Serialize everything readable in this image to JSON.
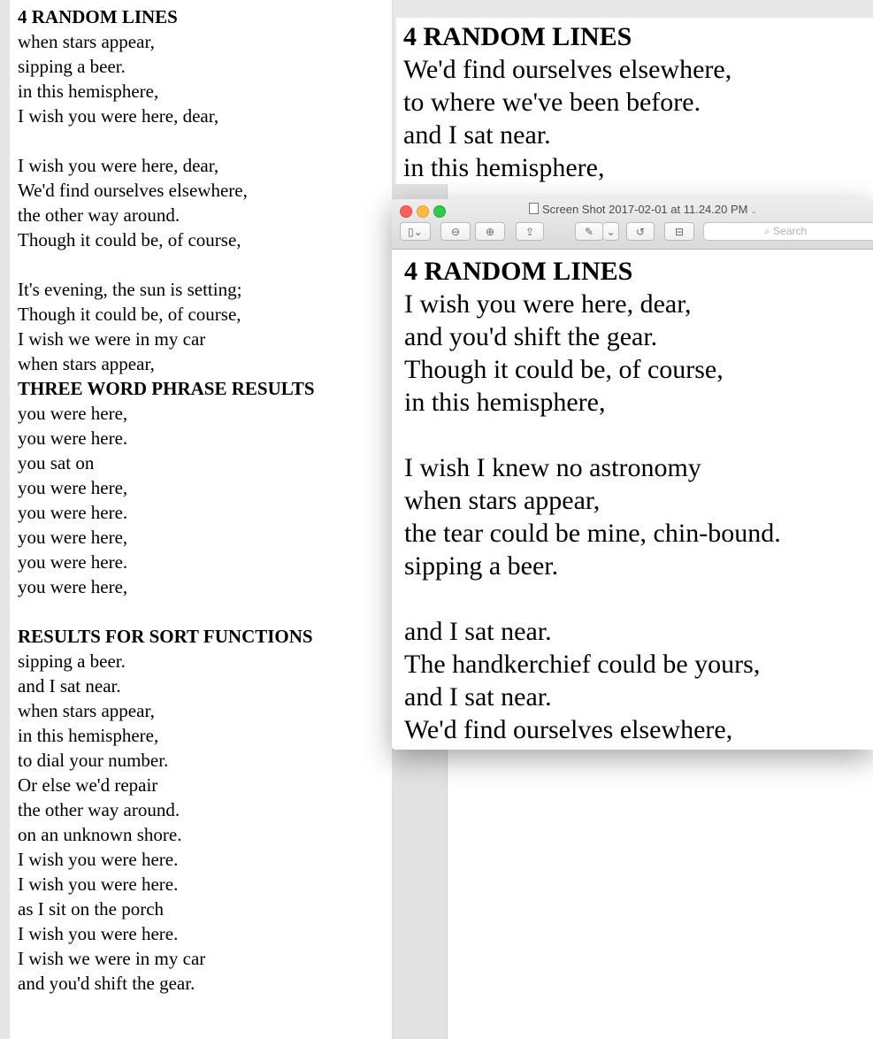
{
  "left_doc": {
    "lines": [
      {
        "text": "4 RANDOM LINES",
        "kind": "heading"
      },
      {
        "text": "when stars appear,",
        "kind": "text"
      },
      {
        "text": "sipping a beer.",
        "kind": "text"
      },
      {
        "text": "in this hemisphere,",
        "kind": "text"
      },
      {
        "text": "I wish you were here, dear,",
        "kind": "text"
      },
      {
        "text": "",
        "kind": "blank"
      },
      {
        "text": "I wish you were here, dear,",
        "kind": "text"
      },
      {
        "text": "We'd find ourselves elsewhere,",
        "kind": "text"
      },
      {
        "text": "the other way around.",
        "kind": "text"
      },
      {
        "text": "Though it could be, of course,",
        "kind": "text"
      },
      {
        "text": "",
        "kind": "blank"
      },
      {
        "text": "It's evening, the sun is setting;",
        "kind": "text"
      },
      {
        "text": "Though it could be, of course,",
        "kind": "text"
      },
      {
        "text": "I wish we were in my car",
        "kind": "text"
      },
      {
        "text": "when stars appear,",
        "kind": "text"
      },
      {
        "text": "THREE WORD PHRASE RESULTS",
        "kind": "heading"
      },
      {
        "text": "you were here,",
        "kind": "text"
      },
      {
        "text": "you were here.",
        "kind": "text"
      },
      {
        "text": "you sat on",
        "kind": "text"
      },
      {
        "text": "you were here,",
        "kind": "text"
      },
      {
        "text": "you were here.",
        "kind": "text"
      },
      {
        "text": "you were here,",
        "kind": "text"
      },
      {
        "text": "you were here.",
        "kind": "text"
      },
      {
        "text": "you were here,",
        "kind": "text"
      },
      {
        "text": "",
        "kind": "blank"
      },
      {
        "text": "RESULTS FOR SORT FUNCTIONS",
        "kind": "heading"
      },
      {
        "text": "sipping a beer.",
        "kind": "text"
      },
      {
        "text": "and I sat near.",
        "kind": "text"
      },
      {
        "text": "when stars appear,",
        "kind": "text"
      },
      {
        "text": "in this hemisphere,",
        "kind": "text"
      },
      {
        "text": "to dial your number.",
        "kind": "text"
      },
      {
        "text": "Or else we'd repair",
        "kind": "text"
      },
      {
        "text": "the other way around.",
        "kind": "text"
      },
      {
        "text": "on an unknown shore.",
        "kind": "text"
      },
      {
        "text": "I wish you were here.",
        "kind": "text"
      },
      {
        "text": "I wish you were here.",
        "kind": "text"
      },
      {
        "text": "as I sit on the porch",
        "kind": "text"
      },
      {
        "text": "I wish you were here.",
        "kind": "text"
      },
      {
        "text": "I wish we were in my car",
        "kind": "text"
      },
      {
        "text": "and you'd shift the gear.",
        "kind": "text"
      }
    ]
  },
  "top_window": {
    "lines": [
      {
        "text": "4 RANDOM LINES",
        "kind": "heading"
      },
      {
        "text": "We'd find ourselves elsewhere,",
        "kind": "text"
      },
      {
        "text": "to where we've been before.",
        "kind": "text"
      },
      {
        "text": "and I sat near.",
        "kind": "text"
      },
      {
        "text": "in this hemisphere,",
        "kind": "text"
      }
    ]
  },
  "preview_window": {
    "title": "Screen Shot 2017-02-01 at 11.24.20 PM",
    "title_chevron": "⌄",
    "toolbar": {
      "sidebar_icon": "▯⌄",
      "zoom_out_icon": "⊖",
      "zoom_in_icon": "⊕",
      "share_icon": "⇪",
      "markup_icon": "✎",
      "markup_menu_icon": "⌄",
      "rotate_icon": "↺",
      "toolbox_icon": "⊟",
      "search_icon": "⌕",
      "search_placeholder": "Search"
    },
    "lines": [
      {
        "text": "4 RANDOM LINES",
        "kind": "heading"
      },
      {
        "text": "I wish you were here, dear,",
        "kind": "text"
      },
      {
        "text": "and you'd shift the gear.",
        "kind": "text"
      },
      {
        "text": "Though it could be, of course,",
        "kind": "text"
      },
      {
        "text": "in this hemisphere,",
        "kind": "text"
      },
      {
        "text": "",
        "kind": "blank"
      },
      {
        "text": "I wish I knew no astronomy",
        "kind": "text"
      },
      {
        "text": "when stars appear,",
        "kind": "text"
      },
      {
        "text": "the tear could be mine, chin-bound.",
        "kind": "text"
      },
      {
        "text": "sipping a beer.",
        "kind": "text"
      },
      {
        "text": "",
        "kind": "blank"
      },
      {
        "text": "and I sat near.",
        "kind": "text"
      },
      {
        "text": "The handkerchief could be yours,",
        "kind": "text"
      },
      {
        "text": "and I sat near.",
        "kind": "text"
      },
      {
        "text": "We'd find ourselves elsewhere,",
        "kind": "text"
      }
    ]
  }
}
